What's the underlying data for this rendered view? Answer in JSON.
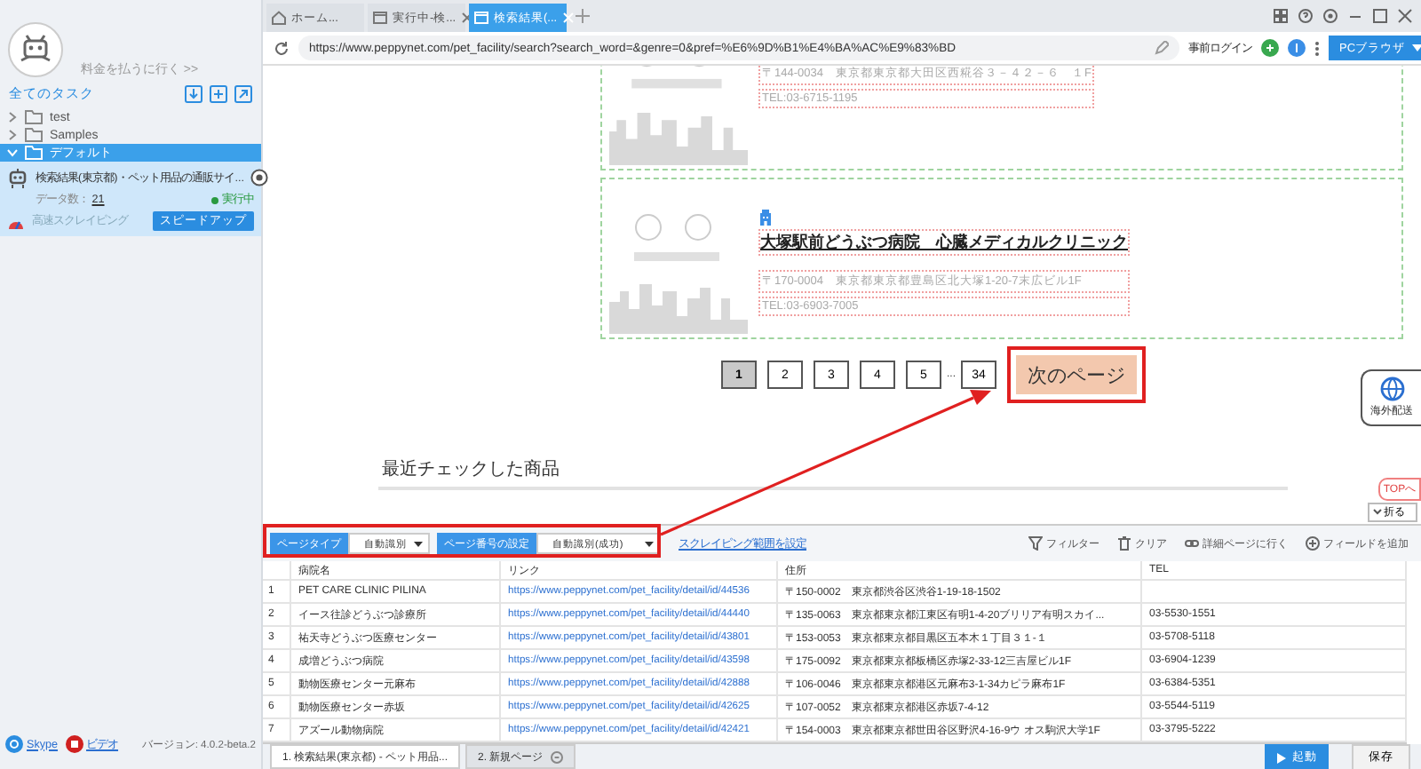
{
  "sidebar": {
    "payment_link": "料金を払うに行く >>",
    "tasks_label": "全てのタスク",
    "folders": [
      {
        "name": "test",
        "expanded": false,
        "selected": false
      },
      {
        "name": "Samples",
        "expanded": false,
        "selected": false
      },
      {
        "name": "デフォルト",
        "expanded": true,
        "selected": true
      }
    ],
    "task": {
      "title": "検索結果(東京都)・ペット用品の通販サイ...",
      "data_label": "データ数：",
      "data_count": "21",
      "status": "実行中",
      "mode": "高速スクレイピング",
      "speed_button": "スピードアップ"
    },
    "links": [
      "Skype",
      "ビデオ"
    ],
    "version": "バージョン: 4.0.2-beta.2"
  },
  "browser": {
    "tabs": [
      {
        "label": "ホーム...",
        "selected": false,
        "closable": false
      },
      {
        "label": "実行中-検...",
        "selected": false,
        "closable": true
      },
      {
        "label": "検索結果(...",
        "selected": true,
        "closable": true
      }
    ],
    "url": "https://www.peppynet.com/pet_facility/search?search_word=&genre=0&pref=%E6%9D%B1%E4%BA%AC%E9%83%BD",
    "login": "事前ログイン",
    "browser_button": "PCブラウザ"
  },
  "page": {
    "listings": [
      {
        "address": "〒144-0034　東京都東京都大田区西糀谷３－４２－６　１F",
        "tel": "TEL:03-6715-1195"
      },
      {
        "title": "大塚駅前どうぶつ病院　心臓メディカルクリニック",
        "address": "〒170-0004　東京都東京都豊島区北大塚1-20-7末広ビル1F",
        "tel": "TEL:03-6903-7005"
      }
    ],
    "pages": [
      {
        "label": "1",
        "selected": true
      },
      {
        "label": "2",
        "selected": false
      },
      {
        "label": "3",
        "selected": false
      },
      {
        "label": "4",
        "selected": false
      },
      {
        "label": "5",
        "selected": false
      }
    ],
    "ellipsis": "...",
    "last_page": "34",
    "next_page": "次のページ",
    "recent_heading": "最近チェックした商品",
    "shipping_badge": "海外配送",
    "top_button": "TOPへ",
    "fold_button": "折る"
  },
  "panel": {
    "page_type_label": "ページタイプ",
    "page_type_value": "自動識別",
    "page_number_label": "ページ番号の設定",
    "page_number_value": "自動識別(成功)",
    "range_link": "スクレイピング範囲を設定",
    "actions": [
      "フィルター",
      "クリア",
      "詳細ページに行く",
      "フィールドを追加"
    ],
    "columns": [
      "病院名",
      "リンク",
      "住所",
      "TEL"
    ],
    "rows": [
      {
        "num": "1",
        "cells": [
          "PET CARE CLINIC PILINA",
          "https://www.peppynet.com/pet_facility/detail/id/44536",
          "〒150-0002　東京都渋谷区渋谷1-19-18-1502"
        ]
      },
      {
        "num": "2",
        "cells": [
          "イース往診どうぶつ診療所",
          "https://www.peppynet.com/pet_facility/detail/id/44440",
          "〒135-0063　東京都東京都江東区有明1-4-20ブリリア有明スカイ...",
          "03-5530-1551"
        ]
      },
      {
        "num": "3",
        "cells": [
          "祐天寺どうぶつ医療センター",
          "https://www.peppynet.com/pet_facility/detail/id/43801",
          "〒153-0053　東京都東京都目黒区五本木１丁目３１-１",
          "03-5708-5118"
        ]
      },
      {
        "num": "4",
        "cells": [
          "成増どうぶつ病院",
          "https://www.peppynet.com/pet_facility/detail/id/43598",
          "〒175-0092　東京都東京都板橋区赤塚2-33-12三吉屋ビル1F",
          "03-6904-1239"
        ]
      },
      {
        "num": "5",
        "cells": [
          "動物医療センター元麻布",
          "https://www.peppynet.com/pet_facility/detail/id/42888",
          "〒106-0046　東京都東京都港区元麻布3-1-34カピラ麻布1F",
          "03-6384-5351"
        ]
      },
      {
        "num": "6",
        "cells": [
          "動物医療センター赤坂",
          "https://www.peppynet.com/pet_facility/detail/id/42625",
          "〒107-0052　東京都東京都港区赤坂7-4-12",
          "03-5544-5119"
        ]
      },
      {
        "num": "7",
        "cells": [
          "アズール動物病院",
          "https://www.peppynet.com/pet_facility/detail/id/42421",
          "〒154-0003　東京都東京都世田谷区野沢4-16-9ウ オス駒沢大学1F",
          "03-3795-5222"
        ]
      }
    ],
    "page_tabs": [
      {
        "label": "1. 検索結果(東京都) - ペット用品...",
        "selected": true
      },
      {
        "label": "2. 新規ページ",
        "selected": false
      }
    ],
    "run_button": "起動",
    "save_button": "保存"
  }
}
